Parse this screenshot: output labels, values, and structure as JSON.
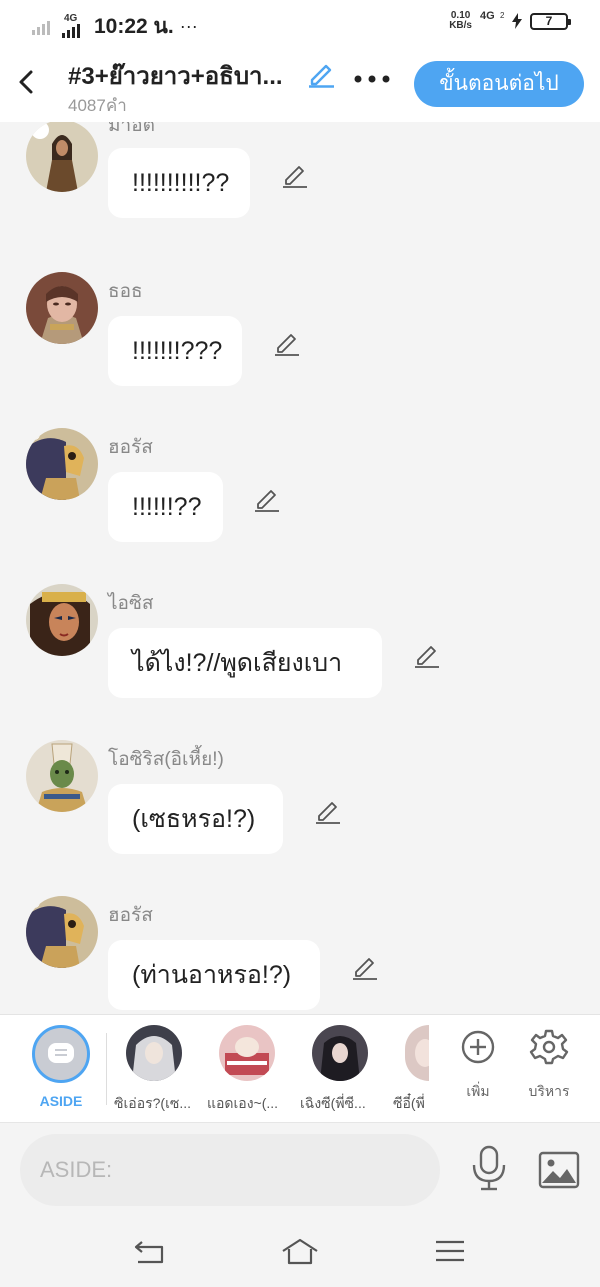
{
  "status": {
    "network_left": "4G",
    "time": "10:22 น.",
    "dots": "···",
    "speed_value": "0.10",
    "speed_unit": "KB/s",
    "network_right": "4G",
    "network_right_sub": "2",
    "battery": "7"
  },
  "header": {
    "title": "#3+ย๊าวยาว+อธิบา...",
    "word_count": "4087คำ",
    "next_label": "ขั้นตอนต่อไป"
  },
  "messages": [
    {
      "sender": "มาอัต",
      "text": "!!!!!!!!!!??"
    },
    {
      "sender": "ธอธ",
      "text": "!!!!!!!???"
    },
    {
      "sender": "ฮอรัส",
      "text": "!!!!!!??"
    },
    {
      "sender": "ไอซิส",
      "text": "ได้ไง!?//พูดเสียงเบา"
    },
    {
      "sender": "โอซิริส(อิเหี้ย!)",
      "text": "(เซธหรอ!?)"
    },
    {
      "sender": "ฮอรัส",
      "text": "(ท่านอาหรอ!?)"
    }
  ],
  "picker": {
    "aside_label": "ASIDE",
    "characters": [
      {
        "label": "ซิเอ่อร?(เซ..."
      },
      {
        "label": "แอดเอง~(..."
      },
      {
        "label": "เฉิงซี(พี่ซี..."
      },
      {
        "label": "ซีอี๋(พี่"
      }
    ],
    "add_label": "เพิ่ม",
    "manage_label": "บริหาร"
  },
  "input": {
    "placeholder": "ASIDE:"
  },
  "colors": {
    "accent": "#4ea5f2",
    "background": "#f4f4f4",
    "bubble": "#ffffff",
    "sender_text": "#888888"
  }
}
